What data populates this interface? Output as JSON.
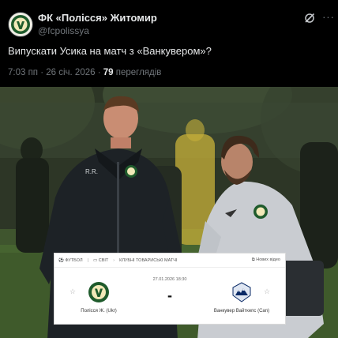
{
  "tweet": {
    "author_name": "ФК «Полісся» Житомир",
    "author_handle": "@fcpolissya",
    "text": "Випускати Усика на матч з «Ванкувером»?",
    "time": "7:03 пп · 26 січ. 2026 · ",
    "views_count": "79",
    "views_label": " переглядів",
    "avatar_icon": "polissya-crest-icon",
    "grok_icon": "grok-icon",
    "more_icon": "more-icon"
  },
  "photo": {
    "jacket_initials": "R.R."
  },
  "match_card": {
    "crumb_sport": "ФУТБОЛ",
    "crumb_region": "СВІТ",
    "crumb_competition": "КЛУБНІ ТОВАРИСЬКІ МАТЧІ",
    "favorites_link": "Нових відео",
    "date": "27.01.2026 18:30",
    "score": "-",
    "home_team": "Полісся Ж. (Ukr)",
    "away_team": "Ванкувер Вайткепс (Can)",
    "star_icon": "☆"
  },
  "colors": {
    "background": "#000000",
    "text_primary": "#e7e9ea",
    "text_secondary": "#71767b",
    "polissya_green": "#1f5b2c",
    "whitecaps_blue": "#0a2a66"
  }
}
